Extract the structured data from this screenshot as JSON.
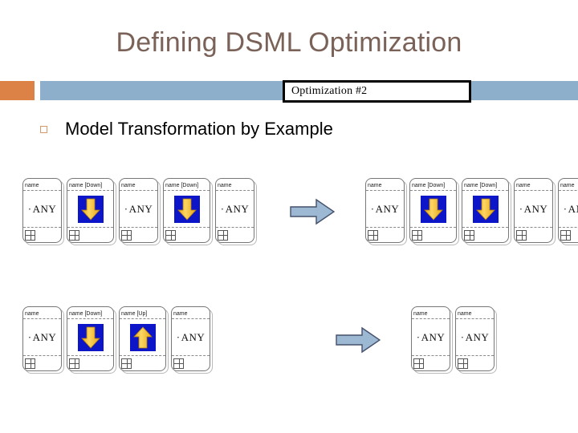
{
  "slide": {
    "title": "Defining DSML Optimization",
    "callout_label": "Optimization #2",
    "bullet_text": "Model Transformation by Example",
    "bullet_marker_icon": "hollow-square-bullet"
  },
  "colors": {
    "title_text": "#7a6258",
    "band_orange": "#dd8247",
    "band_blue": "#8eafcb",
    "callout_border": "#000000",
    "bullet_marker": "#d49a6a",
    "icon_tile_background": "#0c16c8",
    "icon_arrow_fill": "#f5bb1e",
    "connector_arrow_fill": "#9db8d2",
    "connector_arrow_stroke": "#44506b",
    "node_border": "#777777",
    "node_divider": "#8a8a8a"
  },
  "diagram": {
    "node_footer_icon": "grid-2x2-icon",
    "rows": [
      {
        "name": "transformation-rule-1",
        "connector_icon": "right-block-arrow-icon",
        "lhs": [
          {
            "header": "name",
            "content_type": "text",
            "text": "ANY"
          },
          {
            "header": "name [Down]",
            "content_type": "icon",
            "icon": "arrow-down-icon"
          },
          {
            "header": "name",
            "content_type": "text",
            "text": "ANY"
          },
          {
            "header": "name [Down]",
            "content_type": "icon",
            "icon": "arrow-down-icon"
          },
          {
            "header": "name",
            "content_type": "text",
            "text": "ANY"
          }
        ],
        "rhs": [
          {
            "header": "name",
            "content_type": "text",
            "text": "ANY"
          },
          {
            "header": "name [Down]",
            "content_type": "icon",
            "icon": "arrow-down-icon"
          },
          {
            "header": "name [Down]",
            "content_type": "icon",
            "icon": "arrow-down-icon"
          },
          {
            "header": "name",
            "content_type": "text",
            "text": "ANY"
          },
          {
            "header": "name",
            "content_type": "text",
            "text": "ANY"
          }
        ]
      },
      {
        "name": "transformation-rule-2",
        "connector_icon": "right-block-arrow-icon",
        "lhs": [
          {
            "header": "name",
            "content_type": "text",
            "text": "ANY"
          },
          {
            "header": "name [Down]",
            "content_type": "icon",
            "icon": "arrow-down-icon"
          },
          {
            "header": "name [Up]",
            "content_type": "icon",
            "icon": "arrow-up-icon"
          },
          {
            "header": "name",
            "content_type": "text",
            "text": "ANY"
          }
        ],
        "rhs": [
          {
            "header": "name",
            "content_type": "text",
            "text": "ANY"
          },
          {
            "header": "name",
            "content_type": "text",
            "text": "ANY"
          }
        ]
      }
    ]
  }
}
